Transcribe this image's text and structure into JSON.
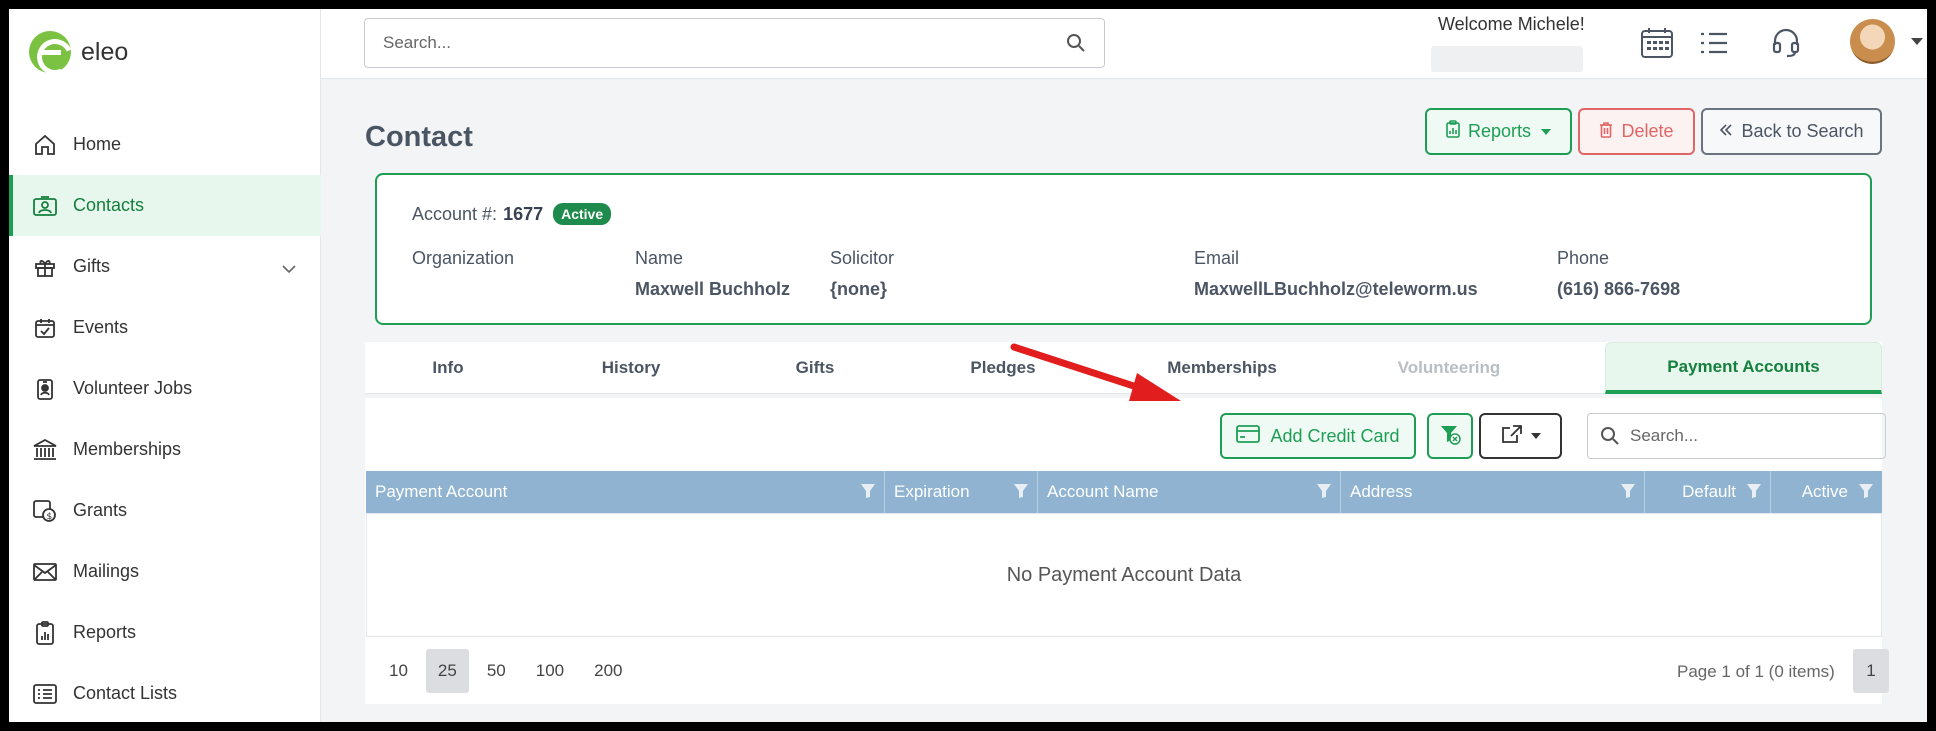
{
  "app": {
    "name": "eleo",
    "accent": "#1e9e55"
  },
  "sidebar": {
    "items": [
      {
        "label": "Home",
        "icon": "home-icon"
      },
      {
        "label": "Contacts",
        "icon": "contact-card-icon",
        "active": true
      },
      {
        "label": "Gifts",
        "icon": "gift-icon",
        "expandable": true
      },
      {
        "label": "Events",
        "icon": "calendar-check-icon"
      },
      {
        "label": "Volunteer Jobs",
        "icon": "badge-icon"
      },
      {
        "label": "Memberships",
        "icon": "bank-icon"
      },
      {
        "label": "Grants",
        "icon": "money-bag-icon"
      },
      {
        "label": "Mailings",
        "icon": "envelope-icon"
      },
      {
        "label": "Reports",
        "icon": "clipboard-chart-icon"
      },
      {
        "label": "Contact Lists",
        "icon": "list-icon"
      }
    ]
  },
  "header": {
    "search_placeholder": "Search...",
    "welcome": "Welcome Michele!"
  },
  "page": {
    "title": "Contact",
    "actions": {
      "reports": "Reports",
      "delete": "Delete",
      "back": "Back to Search"
    }
  },
  "account": {
    "label": "Account #:",
    "number": "1677",
    "status": "Active",
    "fields": [
      {
        "label": "Organization",
        "value": ""
      },
      {
        "label": "Name",
        "value": "Maxwell Buchholz"
      },
      {
        "label": "Solicitor",
        "value": "{none}"
      },
      {
        "label": "Email",
        "value": "MaxwellLBuchholz@teleworm.us"
      },
      {
        "label": "Phone",
        "value": "(616) 866-7698"
      }
    ]
  },
  "tabs": [
    {
      "label": "Info"
    },
    {
      "label": "History"
    },
    {
      "label": "Gifts"
    },
    {
      "label": "Pledges"
    },
    {
      "label": "Memberships"
    },
    {
      "label": "Volunteering",
      "disabled": true
    },
    {
      "label": "Payment Accounts",
      "active": true
    }
  ],
  "grid": {
    "add_button": "Add Credit Card",
    "search_placeholder": "Search...",
    "columns": [
      "Payment Account",
      "Expiration",
      "Account Name",
      "Address",
      "Default",
      "Active"
    ],
    "empty_text": "No Payment Account Data",
    "page_sizes": [
      "10",
      "25",
      "50",
      "100",
      "200"
    ],
    "selected_page_size": "25",
    "page_info": "Page 1 of 1 (0 items)",
    "current_page": "1"
  }
}
